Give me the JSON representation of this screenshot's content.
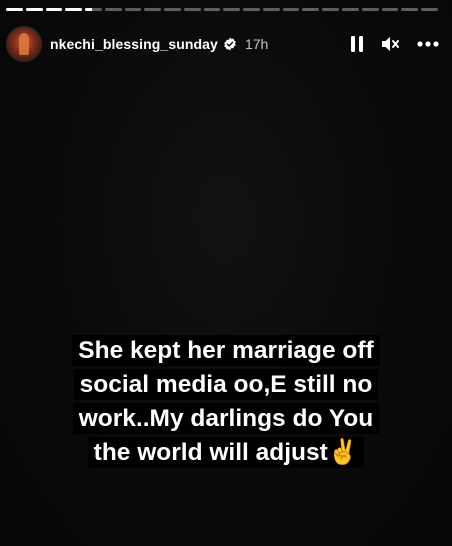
{
  "story": {
    "segments": [
      1,
      1,
      1,
      1,
      0.4,
      0,
      0,
      0,
      0,
      0,
      0,
      0,
      0,
      0,
      0,
      0,
      0,
      0,
      0,
      0,
      0,
      0
    ]
  },
  "header": {
    "username": "nkechi_blessing_sunday",
    "verified": true,
    "time": "17h",
    "avatar_icon": "profile-avatar",
    "pause_icon": "pause-icon",
    "mute_icon": "muted-speaker-icon",
    "more_icon": "more-horizontal-icon"
  },
  "caption": {
    "lines": [
      "She kept her marriage off",
      "social media oo,E still no",
      "work..My darlings do You",
      "the world will adjust✌️"
    ]
  },
  "colors": {
    "background": "#080808",
    "text": "#ffffff",
    "verified_badge": "#3897f0"
  }
}
